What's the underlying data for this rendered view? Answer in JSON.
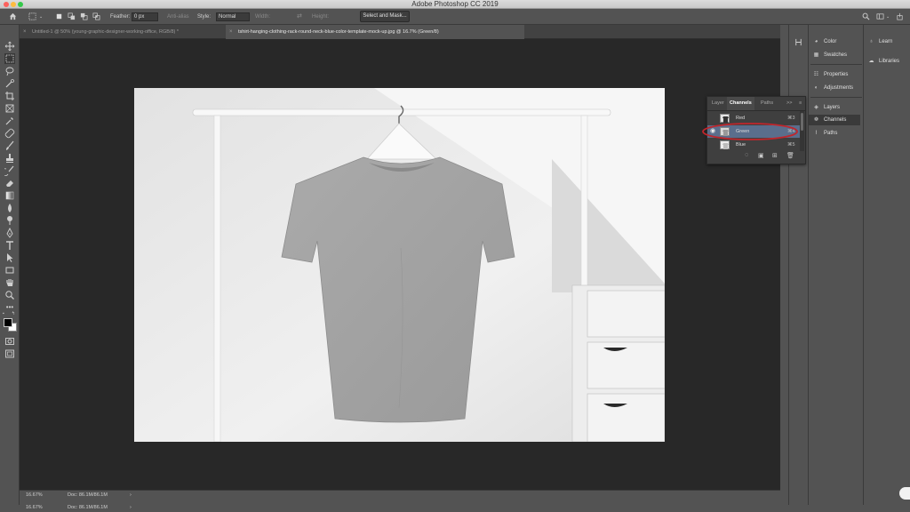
{
  "window": {
    "title": "Adobe Photoshop CC 2019",
    "traffic_colors": [
      "#fc615d",
      "#fdbc40",
      "#34c84a"
    ]
  },
  "options_bar": {
    "feather_label": "Feather:",
    "feather_value": "0 px",
    "antialias_label": "Anti-alias",
    "style_label": "Style:",
    "style_value": "Normal",
    "width_label": "Width:",
    "height_label": "Height:",
    "select_mask_button": "Select and Mask..."
  },
  "tabs": [
    {
      "label": "Untitled-1 @ 50% (young-graphic-designer-working-office, RGB/8) *",
      "close": "×",
      "active": false
    },
    {
      "label": "tshirt-hanging-clothing-rack-round-neck-blue-color-template-mock-up.jpg @ 16.7% (Green/8)",
      "close": "×",
      "active": true
    }
  ],
  "toolbar": {
    "icons": [
      "move-icon",
      "marquee-icon",
      "lasso-icon",
      "quick-select-icon",
      "crop-icon",
      "frame-icon",
      "eyedropper-icon",
      "healing-brush-icon",
      "brush-icon",
      "stamp-icon",
      "history-brush-icon",
      "eraser-icon",
      "gradient-icon",
      "blur-icon",
      "dodge-icon",
      "pen-icon",
      "type-icon",
      "path-select-icon",
      "rectangle-icon",
      "hand-icon",
      "zoom-icon",
      "more-icon"
    ]
  },
  "status": {
    "zoom": "16.67%",
    "doc": "Doc: 86.1M/86.1M",
    "arrow": "›",
    "zoom2": "16.67%",
    "doc2": "Doc: 86.1M/86.1M",
    "arrow2": "›"
  },
  "dock_middle": [
    {
      "label": "Color",
      "icon": "color-wheel-icon"
    },
    {
      "label": "Swatches",
      "icon": "swatches-icon"
    },
    {
      "label": "Properties",
      "icon": "properties-icon"
    },
    {
      "label": "Adjustments",
      "icon": "adjustments-icon"
    },
    {
      "label": "Layers",
      "icon": "layers-icon"
    },
    {
      "label": "Channels",
      "icon": "channels-icon",
      "active": true
    },
    {
      "label": "Paths",
      "icon": "paths-icon"
    }
  ],
  "dock_right": [
    {
      "label": "Learn",
      "icon": "lightbulb-icon"
    },
    {
      "label": "Libraries",
      "icon": "libraries-icon"
    }
  ],
  "channels_panel": {
    "tabs": [
      "Layer",
      "Channels",
      "Paths"
    ],
    "active_tab": "Channels",
    "collapse": ">>",
    "menu": "≡",
    "channels": [
      {
        "name": "Red",
        "shortcut": "⌘3",
        "visible": false,
        "selected": false
      },
      {
        "name": "Green",
        "shortcut": "⌘4",
        "visible": true,
        "selected": true
      },
      {
        "name": "Blue",
        "shortcut": "⌘5",
        "visible": false,
        "selected": false
      }
    ],
    "highlight_color": "#c0262c"
  },
  "colors": {
    "ui_bg": "#535353",
    "canvas_bg": "#282828",
    "selected_row": "#5a6e8c"
  }
}
